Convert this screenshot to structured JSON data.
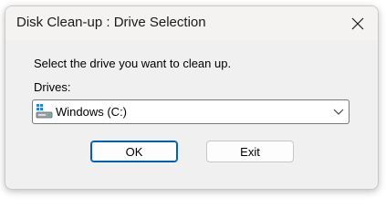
{
  "window": {
    "title": "Disk Clean-up : Drive Selection",
    "close_icon": "close-icon"
  },
  "content": {
    "prompt": "Select the drive you want to clean up.",
    "drives_label": "Drives:",
    "drive_select": {
      "selected": "Windows (C:)",
      "icon": "drive-icon"
    }
  },
  "buttons": {
    "ok_label": "OK",
    "exit_label": "Exit"
  },
  "colors": {
    "accent": "#005fb8",
    "dialog_bg": "#f0f0f0"
  }
}
